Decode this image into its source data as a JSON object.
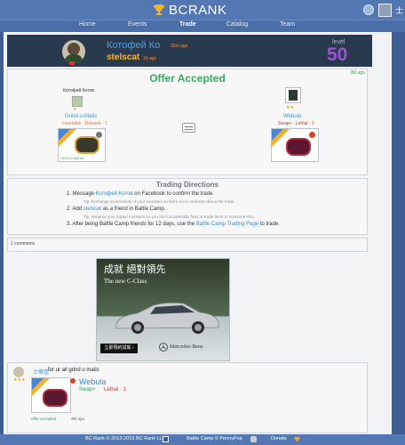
{
  "header": {
    "logo": "BCRANK",
    "user_label": "士"
  },
  "nav": [
    "Home",
    "Events",
    "Trade",
    "Catalog",
    "Team"
  ],
  "profile": {
    "name": "Котофей Ко",
    "name_time": "32m ago",
    "username": "stelscat",
    "username_time": "1h ago",
    "level_label": "level",
    "level": "50"
  },
  "offer": {
    "title": "Offer Accepted",
    "time": "3M ago",
    "left": {
      "trader": "Котофей Котов",
      "monster": "Grind-o-Matic",
      "tags": "Levelable · Bulwark · 1",
      "bonus": "+30% in spd sb"
    },
    "right": {
      "monster": "Webula",
      "tags": "Swap+ · Lethal · 1"
    }
  },
  "directions": {
    "title": "Trading Directions",
    "step1_pre": "1. Message",
    "step1_link": "Котофей Котов",
    "step1_post": "on Facebook to confirm the trade.",
    "tip1": "Tip: Exchange screenshots of your monsters so there is no confusion about the trade.",
    "step2_pre": "2. Add",
    "step2_link": "stelscat",
    "step2_post": "as a friend in Battle Camp.",
    "tip2": "Tip: Rename your traded monsters so you don't accidentally feed or trade them to someone else.",
    "step3_pre": "3. After being Battle Camp friends for 12 days, use the",
    "step3_link": "Battle Camp Trading Page",
    "step3_post": "to trade."
  },
  "comments": {
    "count": "1 comments"
  },
  "ad": {
    "title": "成就 絕對領先",
    "subtitle": "The new C-Class",
    "button": "立即預約試駕 ›",
    "brand": "Mercedes-Benz"
  },
  "comment": {
    "user": "士俵佳",
    "text": "for ur all grind o matic",
    "monster": "Webula",
    "swap": "Swap+",
    "lethal": "Lethal · 1",
    "status": "offer accepted",
    "time": "3M ago"
  },
  "footer": {
    "copyright": "BC Rank © 2013-2015 BC Rank LLC",
    "battlecamp": "Battle Camp © PennyPop",
    "donate": "Donate"
  },
  "colors": {
    "header": "#5277b3",
    "banner": "#2a3a4e",
    "accept": "#3aa866",
    "link": "#2f8fd6",
    "level": "#9b53d6"
  }
}
